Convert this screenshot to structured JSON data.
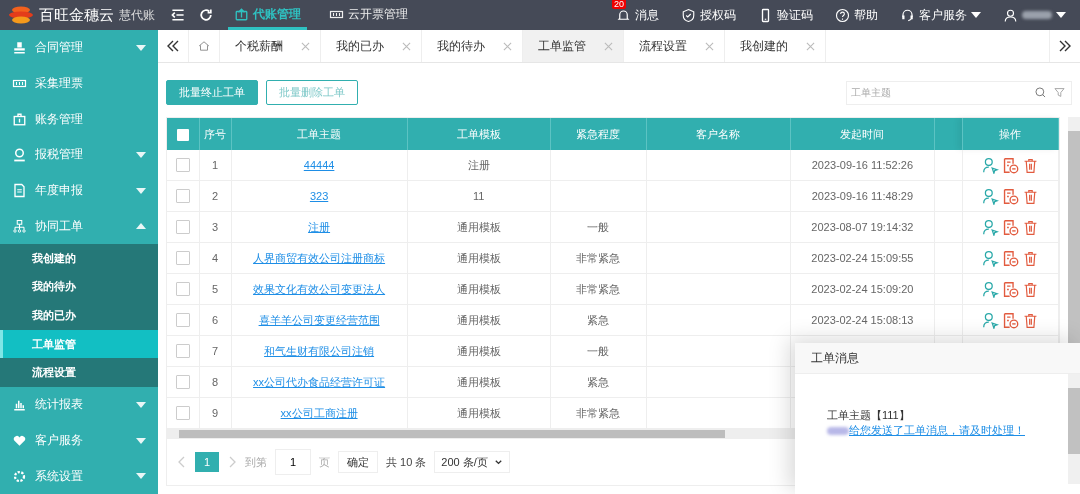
{
  "header": {
    "logo_title": "百旺金穗云",
    "logo_subtitle": "慧代账",
    "nav": [
      {
        "label": "代账管理",
        "kind": "upload",
        "selected": true
      },
      {
        "label": "云开票管理",
        "kind": "ticket",
        "selected": false
      }
    ],
    "actions": [
      {
        "label": "消息",
        "kind": "bell",
        "badge": "20"
      },
      {
        "label": "授权码",
        "kind": "shield"
      },
      {
        "label": "验证码",
        "kind": "phone"
      },
      {
        "label": "帮助",
        "kind": "help"
      },
      {
        "label": "客户服务",
        "kind": "headset",
        "dropdown": true
      },
      {
        "kind": "user",
        "dropdown": true
      }
    ]
  },
  "sidebar": {
    "items": [
      {
        "label": "合同管理",
        "kind": "stamp",
        "expanded": false
      },
      {
        "label": "采集理票",
        "kind": "ticket"
      },
      {
        "label": "账务管理",
        "kind": "briefcase"
      },
      {
        "label": "报税管理",
        "kind": "person",
        "expanded": false
      },
      {
        "label": "年度申报",
        "kind": "doc",
        "expanded": false
      },
      {
        "label": "协同工单",
        "kind": "org",
        "expanded": true,
        "children": [
          {
            "label": "我创建的",
            "selected": false
          },
          {
            "label": "我的待办",
            "selected": false
          },
          {
            "label": "我的已办",
            "selected": false
          },
          {
            "label": "工单监管",
            "selected": true
          },
          {
            "label": "流程设置",
            "selected": false
          }
        ]
      },
      {
        "label": "统计报表",
        "kind": "chart",
        "expanded": false
      },
      {
        "label": "客户服务",
        "kind": "heart",
        "expanded": false
      },
      {
        "label": "系统设置",
        "kind": "gear",
        "expanded": false
      }
    ]
  },
  "tabs": [
    {
      "label": "个税薪酬",
      "selected": false
    },
    {
      "label": "我的已办",
      "selected": false
    },
    {
      "label": "我的待办",
      "selected": false
    },
    {
      "label": "工单监管",
      "selected": true
    },
    {
      "label": "流程设置",
      "selected": false
    },
    {
      "label": "我创建的",
      "selected": false
    }
  ],
  "toolbar": {
    "buttons": [
      {
        "label": "批量终止工单",
        "kind": "primary"
      },
      {
        "label": "批量删除工单",
        "kind": "outline"
      }
    ],
    "search": {
      "placeholder": "工单主题"
    }
  },
  "table": {
    "columns": [
      "序号",
      "工单主题",
      "工单模板",
      "紧急程度",
      "客户名称",
      "发起时间",
      "",
      "操作"
    ],
    "header_checked": false,
    "rows": [
      {
        "checked": false,
        "no": "1",
        "subject": "44444",
        "template": "注册",
        "urgency": "",
        "customer": "",
        "time": "2023-09-16 11:52:26"
      },
      {
        "checked": false,
        "no": "2",
        "subject": "323",
        "template": "11",
        "urgency": "",
        "customer": "",
        "time": "2023-09-16 11:48:29"
      },
      {
        "checked": false,
        "no": "3",
        "subject": "注册",
        "template": "通用模板",
        "urgency": "一般",
        "customer": "",
        "time": "2023-08-07 19:14:32"
      },
      {
        "checked": false,
        "no": "4",
        "subject": "人界商贸有效公司注册商标",
        "template": "通用模板",
        "urgency": "非常紧急",
        "customer": "",
        "time": "2023-02-24 15:09:55"
      },
      {
        "checked": false,
        "no": "5",
        "subject": "效果文化有效公司变更法人",
        "template": "通用模板",
        "urgency": "非常紧急",
        "customer": "",
        "time": "2023-02-24 15:09:20"
      },
      {
        "checked": false,
        "no": "6",
        "subject": "喜羊羊公司变更经营范围",
        "template": "通用模板",
        "urgency": "紧急",
        "customer": "",
        "time": "2023-02-24 15:08:13"
      },
      {
        "checked": false,
        "no": "7",
        "subject": "和气生财有限公司注销",
        "template": "通用模板",
        "urgency": "一般",
        "customer": "",
        "time": ""
      },
      {
        "checked": false,
        "no": "8",
        "subject": "xx公司代办食品经营许可证",
        "template": "通用模板",
        "urgency": "紧急",
        "customer": "",
        "time": ""
      },
      {
        "checked": false,
        "no": "9",
        "subject": "xx公司工商注册",
        "template": "通用模板",
        "urgency": "非常紧急",
        "customer": "",
        "time": ""
      }
    ]
  },
  "pagination": {
    "pages": [
      {
        "label": "1",
        "selected": true
      }
    ],
    "goto_label": "到第",
    "goto_value": "1",
    "page_label": "页",
    "confirm": "确定",
    "total": "共 10 条",
    "page_size": "200 条/页"
  },
  "popup": {
    "title": "工单消息",
    "subject": "工单主题【111】",
    "message": "给您发送了工单消息，请及时处理！"
  }
}
